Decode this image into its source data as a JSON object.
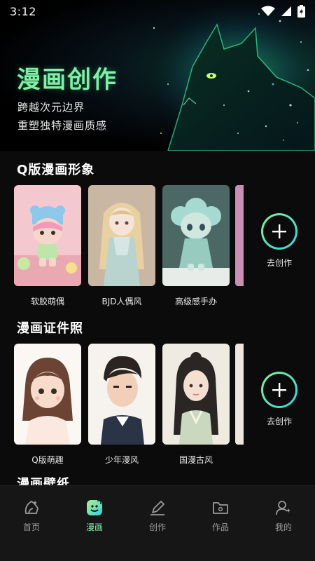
{
  "status_bar": {
    "time": "3:12"
  },
  "hero": {
    "title": "漫画创作",
    "subtitle_line1": "跨越次元边界",
    "subtitle_line2": "重塑独特漫画质感"
  },
  "sections": [
    {
      "title": "Q版漫画形象",
      "cards": [
        {
          "label": "软胶萌偶"
        },
        {
          "label": "BJD人偶风"
        },
        {
          "label": "高级感手办"
        }
      ],
      "create_label": "去创作"
    },
    {
      "title": "漫画证件照",
      "cards": [
        {
          "label": "Q版萌趣"
        },
        {
          "label": "少年漫风"
        },
        {
          "label": "国漫古风"
        }
      ],
      "create_label": "去创作"
    },
    {
      "title": "漫画壁纸"
    }
  ],
  "tab_bar": {
    "items": [
      {
        "label": "首页",
        "icon": "home-icon"
      },
      {
        "label": "漫画",
        "icon": "comic-icon",
        "active": true
      },
      {
        "label": "创作",
        "icon": "pen-icon"
      },
      {
        "label": "作品",
        "icon": "folder-icon"
      },
      {
        "label": "我的",
        "icon": "user-icon"
      }
    ]
  },
  "colors": {
    "accent": "#7ff0a5",
    "accent2": "#3ad0e0",
    "background": "#0b0b0b",
    "tab_bar": "#161616"
  }
}
